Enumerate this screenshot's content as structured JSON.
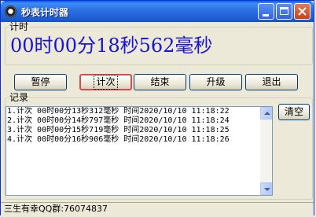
{
  "window": {
    "title": "秒表计时器",
    "icons": {
      "app": "stopwatch-icon",
      "minimize": "minimize-icon",
      "maximize": "maximize-icon",
      "close": "close-icon"
    }
  },
  "timer": {
    "group_label": "计时",
    "display": "00时00分18秒562毫秒",
    "display_color": "#1a13d6"
  },
  "buttons": {
    "pause": "暂停",
    "lap": "计次",
    "stop": "结束",
    "upgrade": "升级",
    "exit": "退出",
    "clear": "清空"
  },
  "records": {
    "group_label": "记录",
    "items": [
      "1.计次 00时00分13秒312毫秒 时间2020/10/10 11:18:22",
      "2.计次 00时00分14秒797毫秒 时间2020/10/10 11:18:24",
      "3.计次 00时00分15秒719毫秒 时间2020/10/10 11:18:25",
      "4.计次 00时00分16秒906毫秒 时间2020/10/10 11:18:26"
    ]
  },
  "status": {
    "text": "三生有幸QQ群:76074837"
  }
}
